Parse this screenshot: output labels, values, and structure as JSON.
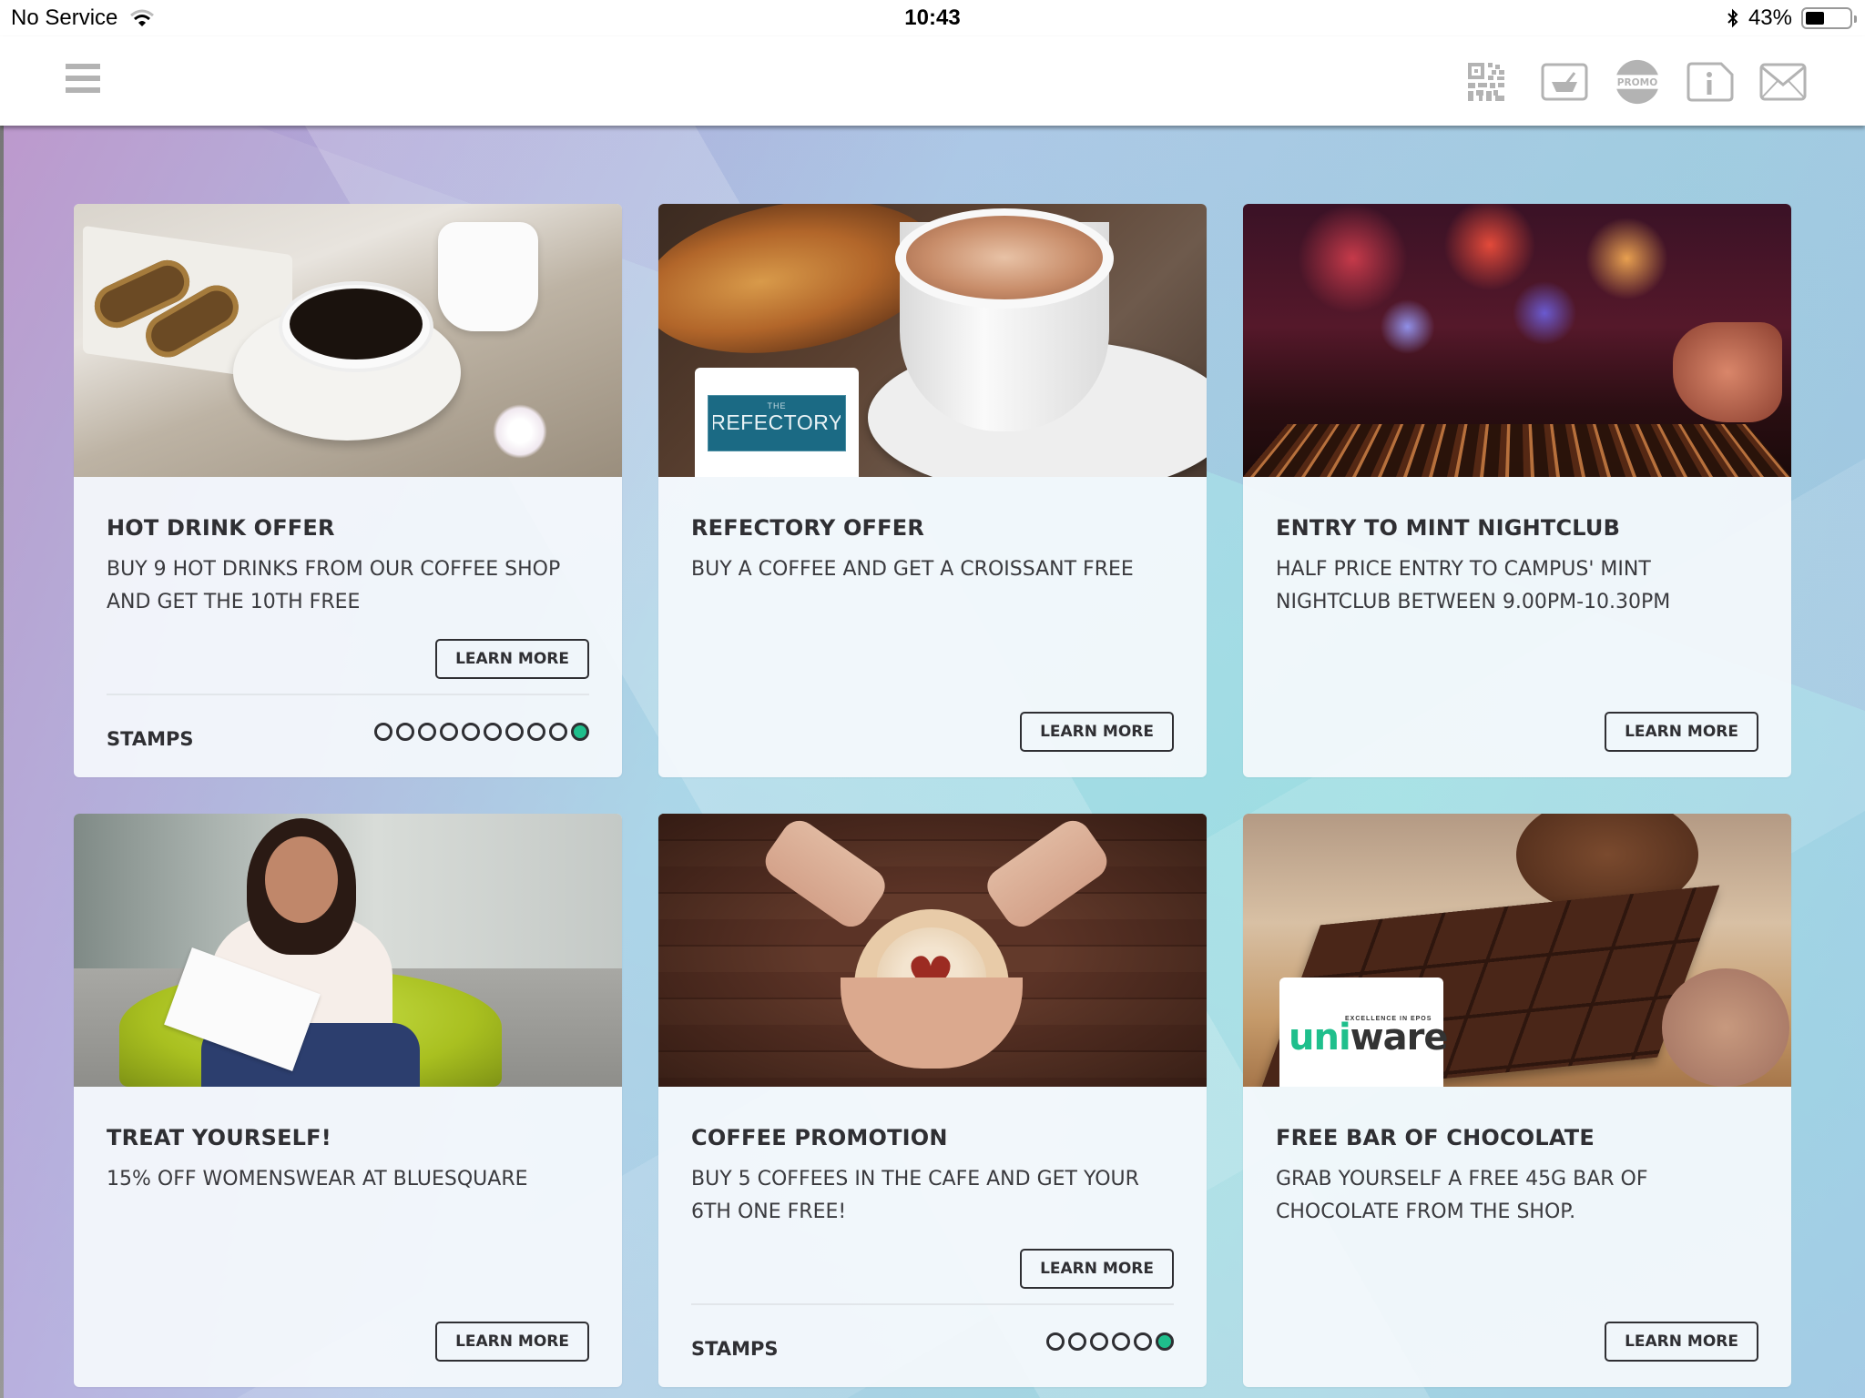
{
  "status_bar": {
    "carrier": "No Service",
    "time": "10:43",
    "battery_percent": "43%",
    "battery_level": 0.43
  },
  "toolbar": {
    "menu_icon": "hamburger-menu-icon",
    "icons": [
      {
        "name": "qr-code-icon"
      },
      {
        "name": "basket-icon"
      },
      {
        "name": "promo-badge-icon",
        "label": "PROMO"
      },
      {
        "name": "info-icon"
      },
      {
        "name": "mail-icon"
      }
    ]
  },
  "colors": {
    "accent_stamp": "#1fbf8c",
    "text_dark": "#2f2f33",
    "icon_gray": "#b3b3b3",
    "refectory_logo_bg": "#1b6a84",
    "uniware_green": "#1fbf8c"
  },
  "cards": [
    {
      "title": "HOT DRINK OFFER",
      "description": "BUY 9 HOT DRINKS FROM OUR COFFEE SHOP AND GET THE 10TH FREE",
      "button": "LEARN MORE",
      "image": "coffee-and-pastries-photo",
      "stamps": {
        "label": "STAMPS",
        "total": 10,
        "filled": 1
      }
    },
    {
      "title": "REFECTORY OFFER",
      "description": "BUY A COFFEE AND GET A CROISSANT FREE",
      "button": "LEARN MORE",
      "image": "cappuccino-croissant-photo",
      "logo": {
        "small": "THE",
        "main": "REFECTORY"
      }
    },
    {
      "title": "ENTRY TO MINT NIGHTCLUB",
      "description": "HALF PRICE ENTRY TO CAMPUS' MINT NIGHTCLUB BETWEEN 9.00PM-10.30PM",
      "button": "LEARN MORE",
      "image": "dj-mixer-photo"
    },
    {
      "title": "TREAT YOURSELF!",
      "description": "15% OFF WOMENSWEAR AT BLUESQUARE",
      "button": "LEARN MORE",
      "image": "smiling-woman-reading-photo"
    },
    {
      "title": "COFFEE PROMOTION",
      "description": "BUY 5 COFFEES IN THE CAFE AND GET YOUR 6TH ONE FREE!",
      "button": "LEARN MORE",
      "image": "heart-latte-hands-photo",
      "stamps": {
        "label": "STAMPS",
        "total": 6,
        "filled": 1
      }
    },
    {
      "title": "FREE BAR OF CHOCOLATE",
      "description": "GRAB YOURSELF A FREE 45G BAR OF CHOCOLATE FROM THE SHOP.",
      "button": "LEARN MORE",
      "image": "chocolate-bar-photo",
      "logo": {
        "tagline": "EXCELLENCE IN EPOS",
        "uni": "uni",
        "ware": "ware"
      }
    }
  ]
}
